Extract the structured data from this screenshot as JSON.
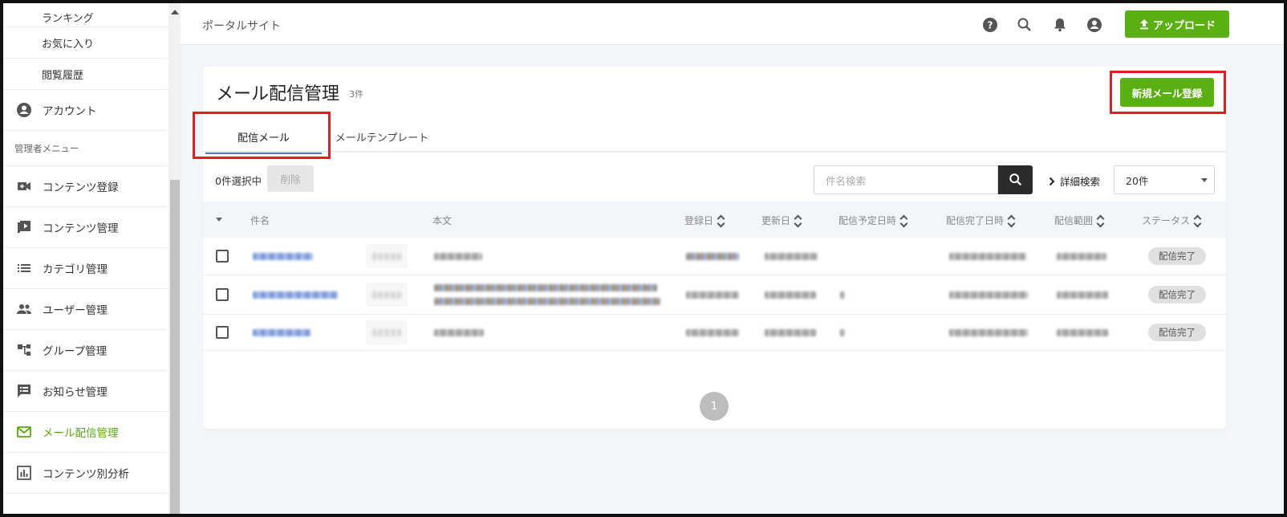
{
  "sidebar": {
    "sub_items": [
      {
        "label": "ランキング"
      },
      {
        "label": "お気に入り"
      },
      {
        "label": "閲覧履歴"
      }
    ],
    "account": {
      "label": "アカウント",
      "icon": "account-circle-icon"
    },
    "admin_section": "管理者メニュー",
    "admin_items": [
      {
        "label": "コンテンツ登録",
        "icon": "video-add-icon"
      },
      {
        "label": "コンテンツ管理",
        "icon": "video-library-icon"
      },
      {
        "label": "カテゴリ管理",
        "icon": "list-icon"
      },
      {
        "label": "ユーザー管理",
        "icon": "people-icon"
      },
      {
        "label": "グループ管理",
        "icon": "tree-icon"
      },
      {
        "label": "お知らせ管理",
        "icon": "announcement-icon"
      },
      {
        "label": "メール配信管理",
        "icon": "mail-icon",
        "active": true
      },
      {
        "label": "コンテンツ別分析",
        "icon": "bar-chart-icon"
      }
    ]
  },
  "header": {
    "site_name": "ポータルサイト",
    "upload_label": "アップロード"
  },
  "main": {
    "title": "メール配信管理",
    "count": "3件",
    "new_button": "新規メール登録",
    "tabs": [
      {
        "label": "配信メール",
        "active": true
      },
      {
        "label": "メールテンプレート"
      }
    ],
    "toolbar": {
      "selected": "0件選択中",
      "delete_label": "削除",
      "search_placeholder": "件名検索",
      "advanced_search": "詳細検索",
      "per_page": "20件"
    },
    "columns": [
      "件名",
      "本文",
      "登録日",
      "更新日",
      "配信予定日時",
      "配信完了日時",
      "配信範囲",
      "ステータス"
    ],
    "rows": [
      {
        "status": "配信完了"
      },
      {
        "status": "配信完了"
      },
      {
        "status": "配信完了"
      }
    ],
    "page": "1"
  },
  "colors": {
    "accent_green": "#5aaf12",
    "highlight_red": "#e01e25",
    "tab_underline": "#4a7fd4"
  }
}
